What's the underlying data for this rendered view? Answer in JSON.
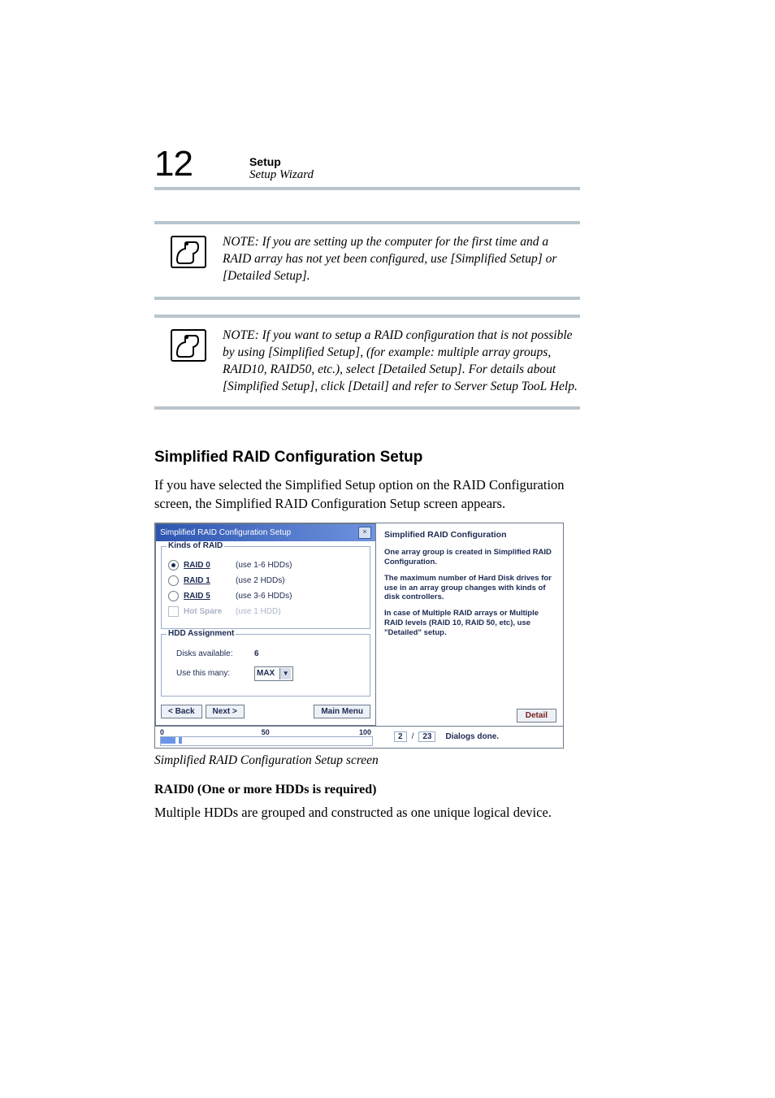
{
  "header": {
    "page_number": "12",
    "title": "Setup",
    "subtitle": "Setup Wizard"
  },
  "notes": [
    "NOTE: If you are setting up the computer for the first time and a RAID array has not yet been configured, use [Simplified Setup] or [Detailed Setup].",
    "NOTE: If you want to setup a RAID configuration that is not possible by using [Simplified Setup], (for example: multiple array groups, RAID10, RAID50, etc.), select [Detailed Setup]. For details about [Simplified Setup], click [Detail] and refer to Server Setup TooL Help."
  ],
  "section_heading": "Simplified RAID Configuration Setup",
  "section_intro": "If you have selected the Simplified Setup option on the RAID Configuration screen, the Simplified RAID Configuration Setup screen appears.",
  "figure_caption": "Simplified RAID Configuration Setup screen",
  "sub_heading": "RAID0  (One or more HDDs is required)",
  "sub_body": "Multiple HDDs are grouped and constructed as  one unique logical device.",
  "dialog": {
    "title": "Simplified RAID Configuration Setup",
    "kinds_group": "Kinds of RAID",
    "options": [
      {
        "label": "RAID 0",
        "hint": "(use 1-6 HDDs)",
        "selected": true,
        "enabled": true,
        "type": "radio"
      },
      {
        "label": "RAID 1",
        "hint": "(use 2 HDDs)",
        "selected": false,
        "enabled": true,
        "type": "radio"
      },
      {
        "label": "RAID 5",
        "hint": "(use 3-6 HDDs)",
        "selected": false,
        "enabled": true,
        "type": "radio"
      },
      {
        "label": "Hot Spare",
        "hint": "(use 1 HDD)",
        "selected": false,
        "enabled": false,
        "type": "checkbox"
      }
    ],
    "hdd_group": "HDD Assignment",
    "disks_available_label": "Disks available:",
    "disks_available_value": "6",
    "use_this_many_label": "Use this many:",
    "use_this_many_value": "MAX",
    "buttons": {
      "back": "< Back",
      "next": "Next >",
      "main": "Main Menu"
    },
    "help": {
      "title": "Simplified RAID Configuration",
      "p1": "One array group is created in Simplified RAID Configuration.",
      "p2": "The maximum number of Hard Disk drives for use in an array group changes with kinds of disk controllers.",
      "p3": "In case of Multiple RAID arrays or Multiple RAID levels (RAID 10, RAID 50, etc), use \"Detailed\" setup.",
      "detail_btn": "Detail"
    },
    "progress": {
      "min": "0",
      "mid": "50",
      "max": "100",
      "current": "2",
      "total": "23",
      "status": "Dialogs done.",
      "fill_percent": 10
    }
  }
}
